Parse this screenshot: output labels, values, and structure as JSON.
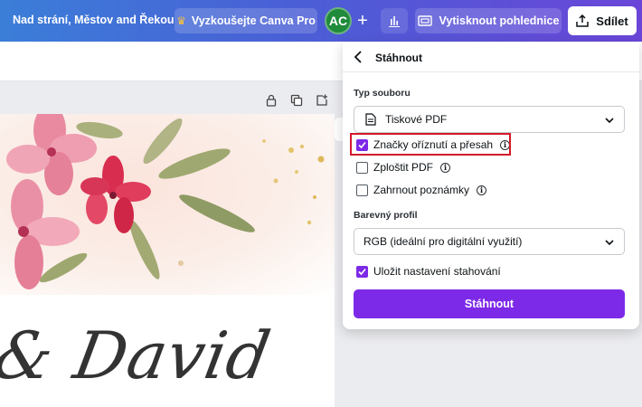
{
  "topbar": {
    "doc_title": "Nad strání, Městov and Řekou",
    "try_pro_label": "Vyzkoušejte Canva Pro",
    "avatar_initials": "AC",
    "print_label": "Vytisknout pohlednice",
    "share_label": "Sdílet"
  },
  "canvas": {
    "names_text": "& David"
  },
  "panel": {
    "title": "Stáhnout",
    "file_type_label": "Typ souboru",
    "file_type_value": "Tiskové PDF",
    "options": [
      {
        "label": "Značky oříznutí a přesah",
        "checked": true,
        "info": true
      },
      {
        "label": "Zploštit PDF",
        "checked": false,
        "info": true
      },
      {
        "label": "Zahrnout poznámky",
        "checked": false,
        "info": true
      }
    ],
    "color_profile_label": "Barevný profil",
    "color_profile_value": "RGB (ideální pro digitální využití)",
    "save_settings_label": "Uložit nastavení stahování",
    "save_settings_checked": true,
    "download_label": "Stáhnout"
  },
  "colors": {
    "accent": "#7d2ae8",
    "highlight": "#d3192b"
  }
}
